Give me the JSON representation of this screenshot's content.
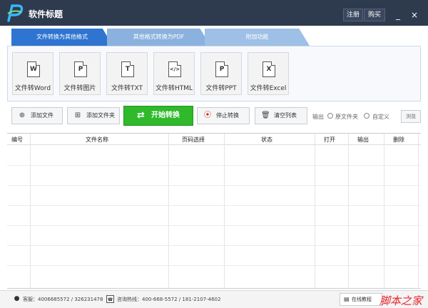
{
  "window": {
    "title": "软件标题",
    "register": "注册",
    "buy": "购买",
    "minimize": "_",
    "close": "×"
  },
  "tabs": [
    {
      "label": "文件转换为其他格式",
      "active": true
    },
    {
      "label": "其他格式转换为PDF",
      "active": false
    },
    {
      "label": "附加功能",
      "active": false
    }
  ],
  "tools": [
    {
      "label": "文件转Word",
      "glyph": "W",
      "icon": "word-doc-icon"
    },
    {
      "label": "文件转图片",
      "glyph": "P",
      "icon": "image-doc-icon"
    },
    {
      "label": "文件转TXT",
      "glyph": "T",
      "icon": "txt-doc-icon"
    },
    {
      "label": "文件转HTML",
      "glyph": "</>",
      "icon": "html-doc-icon"
    },
    {
      "label": "文件转PPT",
      "glyph": "P",
      "icon": "ppt-doc-icon"
    },
    {
      "label": "文件转Excel",
      "glyph": "X",
      "icon": "excel-doc-icon"
    }
  ],
  "actions": {
    "add_file": "添加文件",
    "add_folder": "添加文件夹",
    "start": "开始转换",
    "stop": "停止转换",
    "clear": "清空列表",
    "output_label": "输出",
    "option_source": "原文件夹",
    "option_custom": "自定义",
    "browse": "浏览"
  },
  "table": {
    "columns": [
      "编号",
      "文件名称",
      "页码选择",
      "状态",
      "打开",
      "输出",
      "删除"
    ]
  },
  "status": {
    "support": "客服：4006685572 / 326231478",
    "hotline": "咨询热线：400-668-5572 / 181-2107-4602",
    "tutorial": "在线教程",
    "watermark": "脚本之家"
  },
  "colors": {
    "titlebar": "#2e3a4e",
    "tab_active": "#2f74d0",
    "start_button": "#2fb92b",
    "stop_icon": "#d9241c"
  }
}
